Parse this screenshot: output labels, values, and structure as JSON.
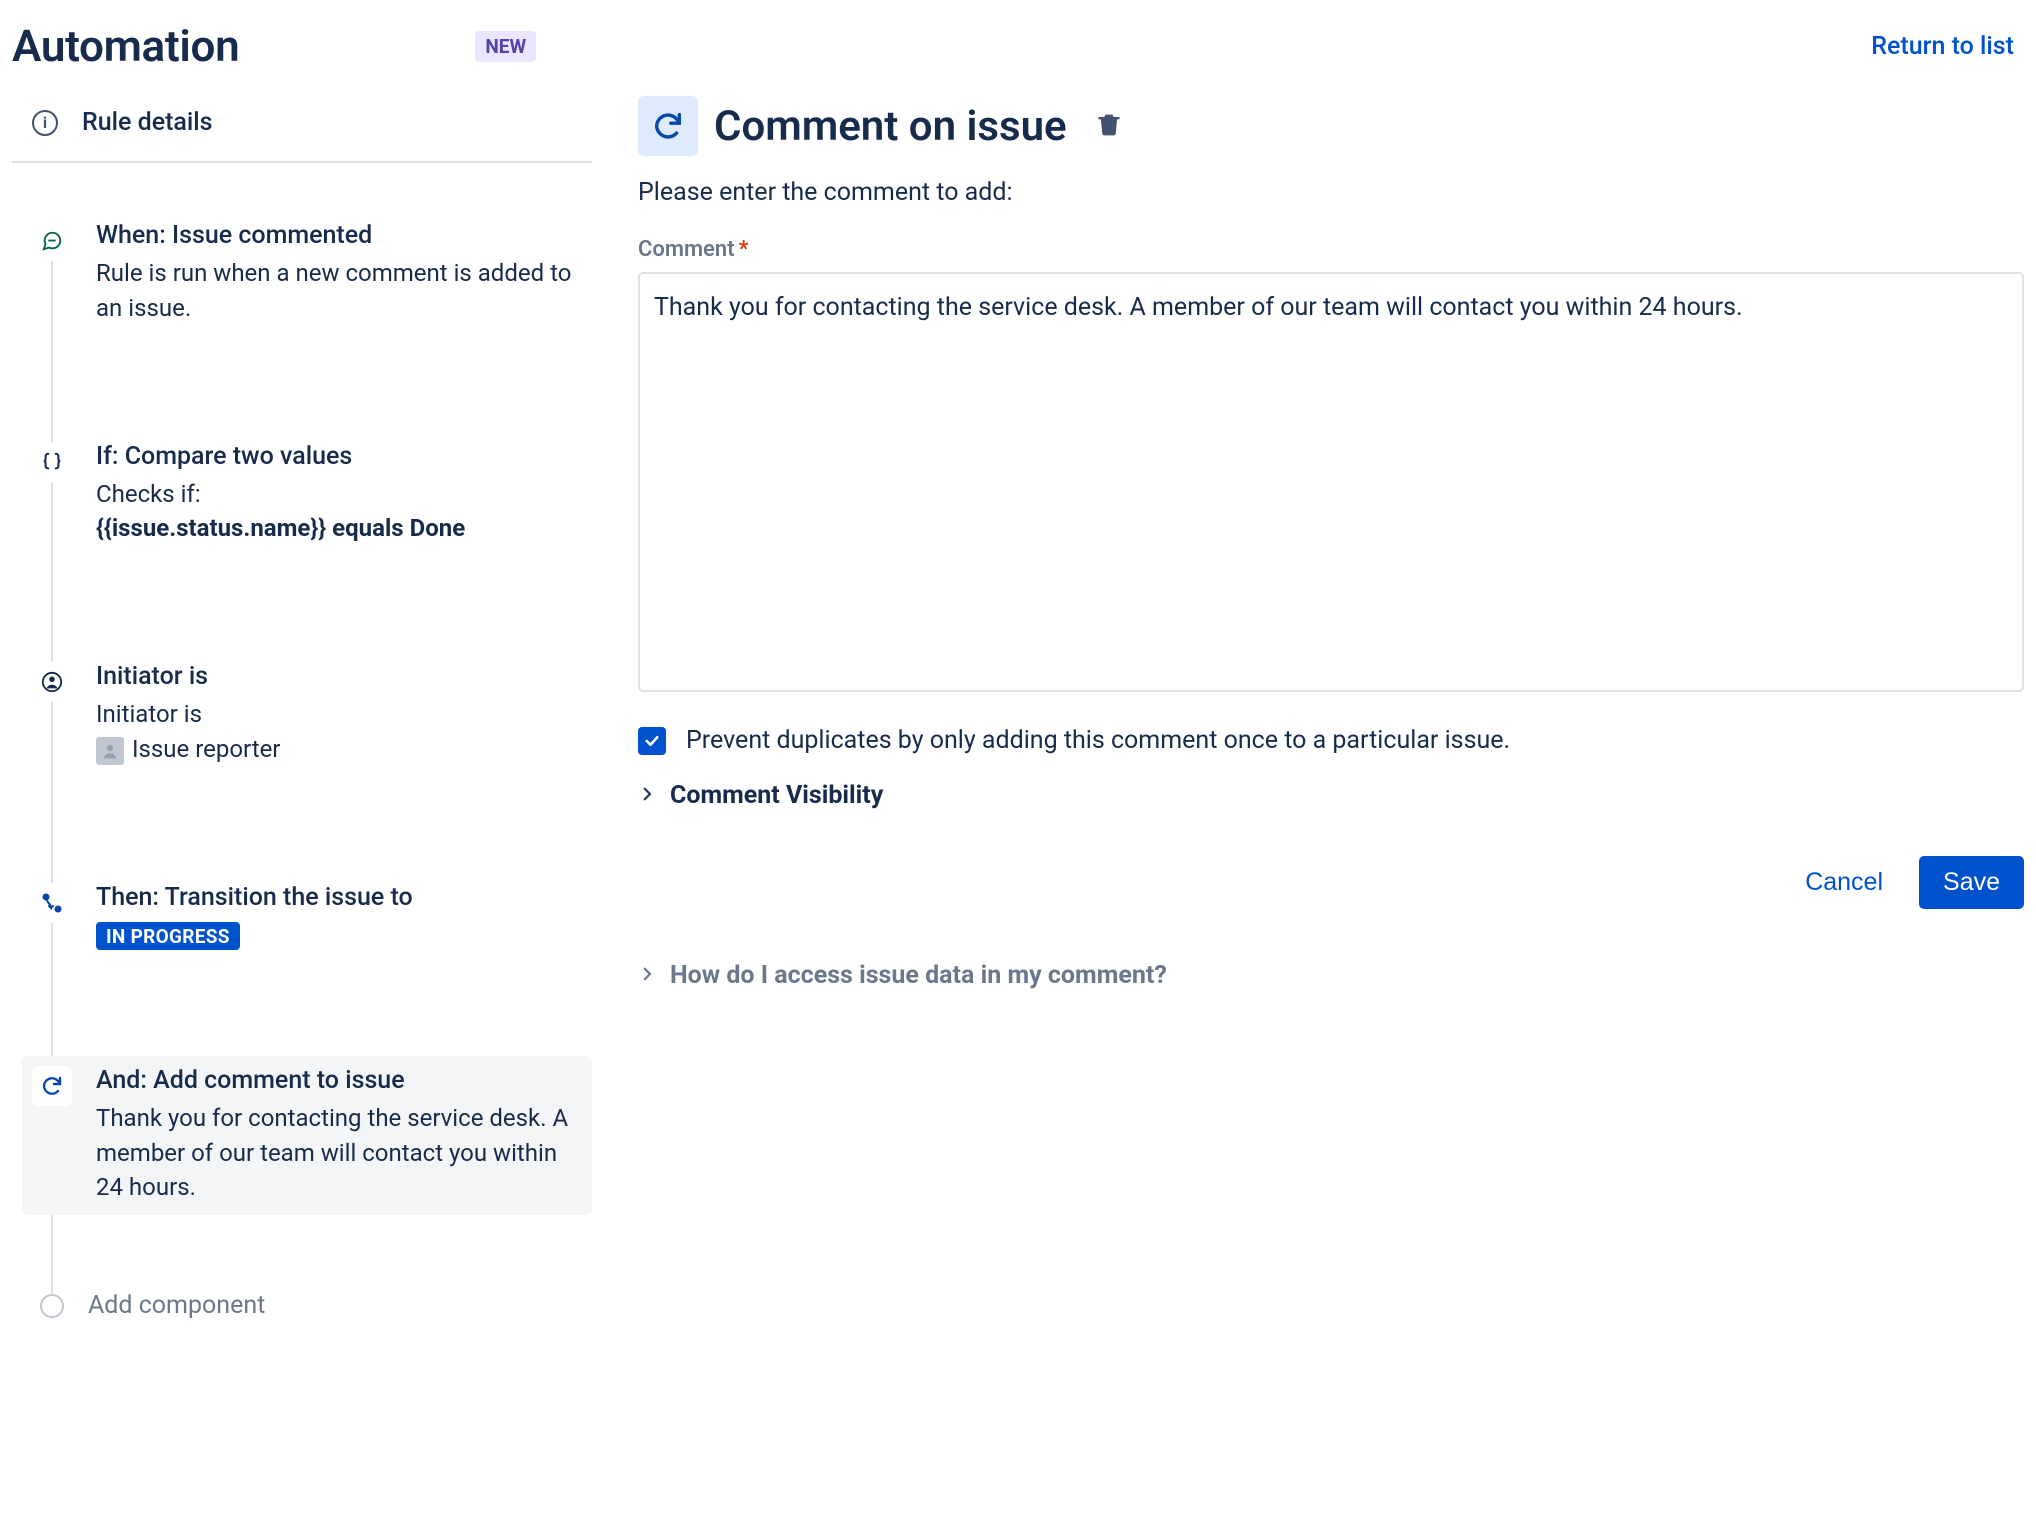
{
  "header": {
    "title": "Automation",
    "badge": "NEW",
    "return_link": "Return to list"
  },
  "sidebar": {
    "rule_details_label": "Rule details",
    "steps": [
      {
        "title": "When: Issue commented",
        "desc": "Rule is run when a new comment is added to an issue."
      },
      {
        "title": "If: Compare two values",
        "desc_prefix": "Checks if:",
        "desc_bold": "{{issue.status.name}} equals Done"
      },
      {
        "title": "Initiator is",
        "desc_prefix": "Initiator is",
        "desc_person": "Issue reporter"
      },
      {
        "title": "Then: Transition the issue to",
        "status_lozenge": "IN PROGRESS"
      },
      {
        "title": "And: Add comment to issue",
        "desc": "Thank you for contacting the service desk. A member of our team will contact you within 24 hours."
      }
    ],
    "add_component_label": "Add component"
  },
  "main": {
    "title": "Comment on issue",
    "prompt": "Please enter the comment to add:",
    "comment_label": "Comment",
    "comment_value": "Thank you for contacting the service desk. A member of our team will contact you within 24 hours.",
    "prevent_duplicates_label": "Prevent duplicates by only adding this comment once to a particular issue.",
    "prevent_duplicates_checked": true,
    "visibility_label": "Comment Visibility",
    "cancel_label": "Cancel",
    "save_label": "Save",
    "help_label": "How do I access issue data in my comment?"
  },
  "colors": {
    "brand": "#0052CC",
    "text": "#172B4D"
  }
}
